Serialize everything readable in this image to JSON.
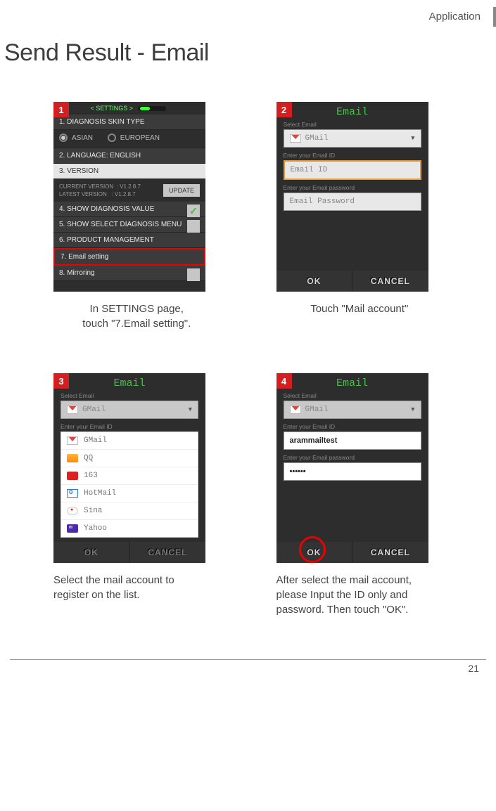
{
  "header": {
    "section": "Application",
    "title": "Send Result - Email"
  },
  "steps": [
    {
      "num": "1",
      "caption_l1": "In SETTINGS page,",
      "caption_l2": "touch \"7.Email setting\".",
      "settings": {
        "title_l": "SETTINGS",
        "row1": "1. DIAGNOSIS SKIN TYPE",
        "radio_a": "ASIAN",
        "radio_b": "EUROPEAN",
        "row2": "2. LANGUAGE: ENGLISH",
        "row3": "3. VERSION",
        "ver_cur_l": "CURRENT VERSION",
        "ver_cur_v": ": V1.2.8.7",
        "ver_lat_l": "LATEST VERSION",
        "ver_lat_v": ": V1.2.8.7",
        "update": "UPDATE",
        "row4": "4. SHOW DIAGNOSIS VALUE",
        "row5": "5. SHOW SELECT DIAGNOSIS MENU",
        "row6": "6. PRODUCT MANAGEMENT",
        "row7": "7. Email setting",
        "row8": "8. Mirroring"
      }
    },
    {
      "num": "2",
      "caption": "Touch \"Mail account\"",
      "email": {
        "title": "Email",
        "sel_label": "Select Email",
        "sel_value": "GMail",
        "id_label": "Enter your Email ID",
        "id_ph": "Email ID",
        "pw_label": "Enter your Email password",
        "pw_ph": "Email Password",
        "ok": "OK",
        "cancel": "CANCEL"
      }
    },
    {
      "num": "3",
      "caption_l1": "Select the mail account to",
      "caption_l2": "register on the list.",
      "email": {
        "title": "Email",
        "sel_label": "Select Email",
        "sel_value": "GMail",
        "id_label": "Enter your Email ID",
        "options": [
          "GMail",
          "QQ",
          "163",
          "HotMail",
          "Sina",
          "Yahoo"
        ],
        "ok": "OK",
        "cancel": "CANCEL"
      }
    },
    {
      "num": "4",
      "caption_l1": "After select the mail account,",
      "caption_l2": "please Input the ID only and",
      "caption_l3": "password. Then touch \"OK\".",
      "email": {
        "title": "Email",
        "sel_label": "Select Email",
        "sel_value": "GMail",
        "id_label": "Enter your Email ID",
        "id_val": "arammailtest",
        "pw_label": "Enter your Email password",
        "pw_val": "••••••",
        "ok": "OK",
        "cancel": "CANCEL"
      }
    }
  ],
  "page_no": "21"
}
